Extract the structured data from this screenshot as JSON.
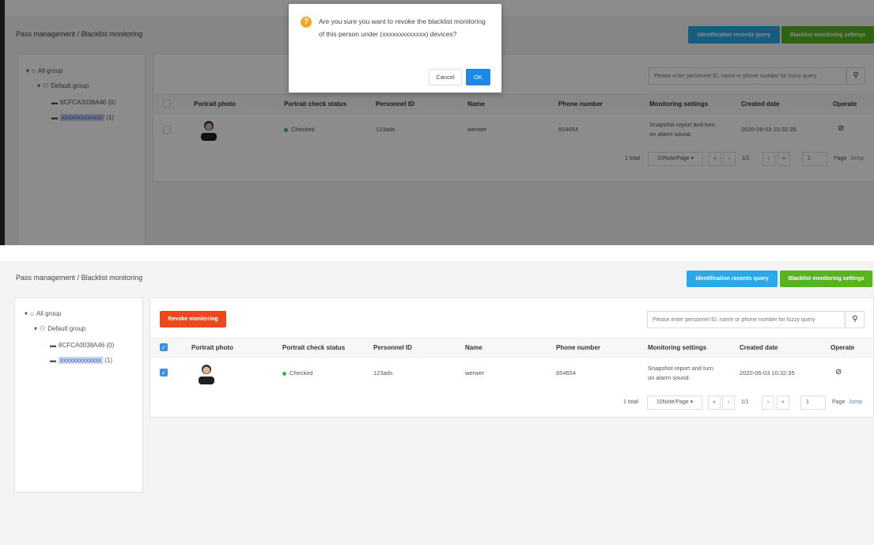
{
  "breadcrumb": {
    "root": "Pass management",
    "sep": "/",
    "current": "Blacklist monitoring"
  },
  "header_buttons": {
    "query": "Identification records query",
    "settings": "Blacklist monitoring settings"
  },
  "tree": {
    "all_group": "All group",
    "default_group": "Default group",
    "devices": [
      {
        "label": "8CFCA0038A46",
        "count": "(0)"
      },
      {
        "label": "xxxxxxxxxxxxx",
        "count": "(1)"
      }
    ]
  },
  "revoke_button": "Revoke monitoring",
  "search": {
    "placeholder": "Please enter personnel ID, name or phone number for fuzzy query"
  },
  "table": {
    "headers": [
      "Portrait photo",
      "Portrait check status",
      "Personnel ID",
      "Name",
      "Phone number",
      "Monitoring settings",
      "Created date",
      "Operate"
    ],
    "row": {
      "status": "Checked",
      "personnel_id": "123ads",
      "name": "werwer",
      "phone": "654654",
      "settings_line1": "Snapshot report and turn",
      "settings_line2": "on alarm sound.",
      "created": "2020-06-03 10:32:35"
    }
  },
  "pagination": {
    "total": "1 total",
    "page_size": "10Note/Page",
    "page_info": "1/1",
    "page_input": "1",
    "page_label": "Page",
    "jump": "Jump"
  },
  "dialog": {
    "message": "Are you sure you want to revoke the blacklist monitoring of this person under (xxxxxxxxxxxxx) devices?",
    "cancel": "Cancel",
    "ok": "OK"
  },
  "colors": {
    "blue": "#29a9ec",
    "green": "#56b51e",
    "red": "#ec4a1a",
    "warning": "#f5a623",
    "checked": "#3cb34a"
  }
}
